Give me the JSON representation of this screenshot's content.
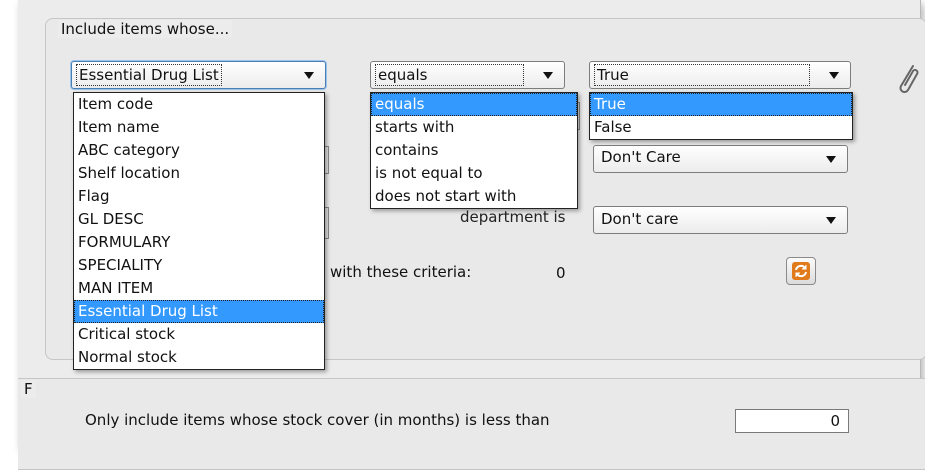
{
  "include_group": {
    "title": "Include items whose..."
  },
  "field_combo": {
    "selected": "Essential Drug List",
    "options": [
      "Item code",
      "Item name",
      "ABC category",
      "Shelf location",
      "Flag",
      "GL DESC",
      "FORMULARY",
      "SPECIALITY",
      "MAN ITEM",
      "Essential Drug List",
      "Critical stock",
      "Normal stock"
    ],
    "highlighted_index": 9
  },
  "operator_combo": {
    "selected": "equals",
    "options": [
      "equals",
      "starts with",
      "contains",
      "is not equal to",
      "does not start with"
    ],
    "highlighted_index": 0
  },
  "value_combo": {
    "selected": "True",
    "options": [
      "True",
      "False"
    ],
    "highlighted_index": 0
  },
  "care_combo": {
    "selected": "Don't Care"
  },
  "department": {
    "label": "department is",
    "selected": "Don't care"
  },
  "criteria": {
    "label": "with these criteria:",
    "count": "0"
  },
  "refresh_button": {
    "icon": "refresh-icon",
    "color": "#e07a1a"
  },
  "attach_icon": {
    "icon": "paperclip-icon"
  },
  "bottom_group": {
    "title_fragment": "F",
    "stock_cover_label": "Only include items whose stock cover (in months) is less than",
    "stock_cover_value": "0"
  },
  "colors": {
    "highlight": "#3399ff",
    "panel": "#ececec",
    "focus_border": "#4a7fb6"
  }
}
